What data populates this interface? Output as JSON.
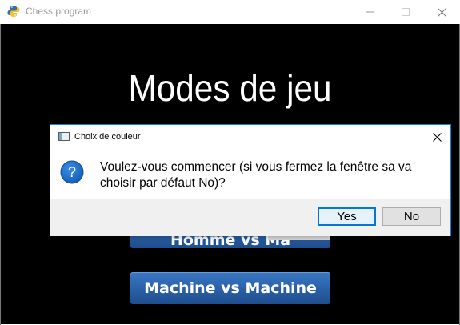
{
  "window": {
    "title": "Chess program",
    "app_icon": "python-icon",
    "controls": [
      "minimize-icon",
      "maximize-icon",
      "close-icon"
    ]
  },
  "main": {
    "heading": "Modes de jeu",
    "partial_button_label": "Homme vs Ma",
    "bottom_button_label": "Machine vs Machine",
    "button_color": "#2a5fa6"
  },
  "dialog": {
    "title": "Choix de couleur",
    "icon": "question-icon",
    "message": "Voulez-vous commencer (si vous fermez la fenêtre sa va choisir par défaut No)?",
    "yes_label": "Yes",
    "no_label": "No",
    "accent_color": "#0078d7"
  }
}
